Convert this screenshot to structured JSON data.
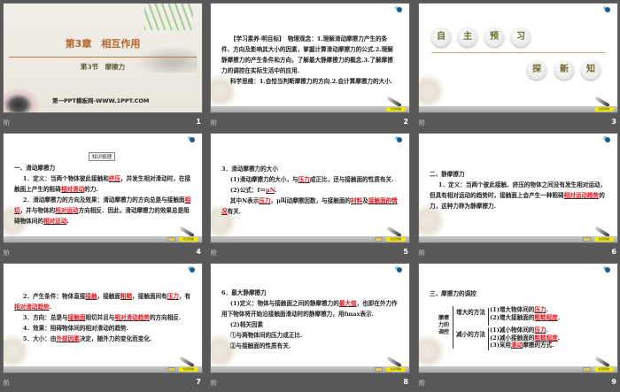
{
  "caption_icon": "阶",
  "footer": {
    "back_label": "返回",
    "nav_label": "栏目导航"
  },
  "slides": [
    {
      "num": "1",
      "title": "第3章　相互作用",
      "subtitle": "第3节　摩擦力",
      "site": "第一PPT模板网-WWW.1PPT.COM"
    },
    {
      "num": "2",
      "paras": [
        [
          {
            "t": "【学习素养·明目标】　物理观念：1.理解滑动摩擦力产生的条件、方向及影响其大小的因素，掌握计算滑动摩擦力的公式.2.理解静摩擦力的产生条件和方向，了解最大静摩擦力的概念.3.了解摩擦力的调控在实际生活中的应用."
          }
        ],
        [
          {
            "t": "科学思维：1.会恰当判断摩擦力的方向.2.会计算摩擦力的大小."
          }
        ]
      ]
    },
    {
      "num": "3",
      "circles_top": [
        "自",
        "主",
        "预",
        "习"
      ],
      "circles_bottom": [
        "探",
        "新",
        "知"
      ]
    },
    {
      "num": "4",
      "box": "知识梳理",
      "paras": [
        [
          {
            "t": "一、滑动摩擦力"
          }
        ],
        [
          {
            "t": "1．定义：当两个物体彼此接触和"
          },
          {
            "t": "挤压",
            "hl": 1
          },
          {
            "t": "，并发生相对滑动时，在接触面上产生的阻碍"
          },
          {
            "t": "相对滑动",
            "hl": 1
          },
          {
            "t": "的力."
          }
        ],
        [
          {
            "t": "2．滑动摩擦力的方向及效果：滑动摩擦力的方向总是与接触面"
          },
          {
            "t": "相切",
            "hl": 1
          },
          {
            "t": "，并与物体的"
          },
          {
            "t": "相对运动",
            "hl": 1
          },
          {
            "t": "方向相反．因此，滑动摩擦力的效果总是阻碍物体间的"
          },
          {
            "t": "相对运动",
            "hl": 1
          },
          {
            "t": "."
          }
        ]
      ]
    },
    {
      "num": "5",
      "paras": [
        [
          {
            "t": "3．滑动摩擦力的大小"
          }
        ],
        [
          {
            "t": "(1)滑动摩擦力的大小，与"
          },
          {
            "t": "压力",
            "hl": 1
          },
          {
            "t": "成正比，还与接触面的性质有关."
          }
        ],
        [
          {
            "t": "(2)公式：f＝"
          },
          {
            "t": "μN",
            "hl": 1
          },
          {
            "t": "."
          }
        ],
        [
          {
            "t": "其中N表示"
          },
          {
            "t": "压力",
            "hl": 1
          },
          {
            "t": "，μ叫动摩擦因数，与接触面的"
          },
          {
            "t": "材料",
            "hl": 1
          },
          {
            "t": "及"
          },
          {
            "t": "接触面的情况",
            "hl": 1
          },
          {
            "t": "有关."
          }
        ]
      ]
    },
    {
      "num": "6",
      "paras": [
        [
          {
            "t": "二、静摩擦力"
          }
        ],
        [
          {
            "t": "1．定义：当两个彼此接触、挤压的物体之间没有发生相对运动，但具有相对运动的趋势时，接触面上会产生一种阻碍"
          },
          {
            "t": "相对运动趋势",
            "hl": 1
          },
          {
            "t": "的力，这种力称为静摩擦力."
          }
        ]
      ]
    },
    {
      "num": "7",
      "paras": [
        [
          {
            "t": "2．产生条件：物体直接"
          },
          {
            "t": "接触",
            "hl": 1
          },
          {
            "t": "，接触面"
          },
          {
            "t": "粗糙",
            "hl": 1
          },
          {
            "t": "，接触面间有"
          },
          {
            "t": "压力",
            "hl": 1
          },
          {
            "t": "，有"
          },
          {
            "t": "相对滑动趋势",
            "hl": 1
          },
          {
            "t": "."
          }
        ],
        [
          {
            "t": "3．方向：总是与"
          },
          {
            "t": "接触面",
            "hl": 1
          },
          {
            "t": "相切并且与"
          },
          {
            "t": "相对滑动趋势",
            "hl": 1
          },
          {
            "t": "的方向相反."
          }
        ],
        [
          {
            "t": "4．效果：阻碍物体间的相对滑动的趋势."
          }
        ],
        [
          {
            "t": "5．大小：由"
          },
          {
            "t": "外部因素",
            "hl": 1
          },
          {
            "t": "决定，随外力的变化而变化."
          }
        ]
      ]
    },
    {
      "num": "8",
      "paras": [
        [
          {
            "t": "6．最大静摩擦力"
          }
        ],
        [
          {
            "t": "(1)定义：物体与接触面之间的静摩擦力的"
          },
          {
            "t": "最大值",
            "hl": 1
          },
          {
            "t": "，也即在外力作用下物体将开始沿接触面滑动时的静摩擦力，用fmax表示."
          }
        ],
        [
          {
            "t": "(2)相关因素"
          }
        ],
        [
          {
            "t": "①与两物体间的压力成正比."
          }
        ],
        [
          {
            "t": "②与接触面的性质有关."
          }
        ]
      ]
    },
    {
      "num": "9",
      "heading": "三、摩擦力的调控",
      "root": "摩擦力的调控",
      "inc": "增大的方法",
      "dec": "减小的方法",
      "inc_items": [
        [
          {
            "t": "(1)增大物体间的"
          },
          {
            "t": "压力",
            "hl": 1
          },
          {
            "t": "."
          }
        ],
        [
          {
            "t": "(2)增大接触面的"
          },
          {
            "t": "粗糙程度",
            "hl": 1
          },
          {
            "t": "."
          }
        ]
      ],
      "dec_items": [
        [
          {
            "t": "(1)减小物体间的"
          },
          {
            "t": "压力",
            "hl": 1
          },
          {
            "t": "."
          }
        ],
        [
          {
            "t": "(2)减小接触面的"
          },
          {
            "t": "粗糙程度",
            "hl": 1
          },
          {
            "t": "."
          }
        ],
        [
          {
            "t": "(3)采用"
          },
          {
            "t": "滚动",
            "hl": 1
          },
          {
            "t": "摩擦的方式."
          }
        ]
      ]
    }
  ]
}
